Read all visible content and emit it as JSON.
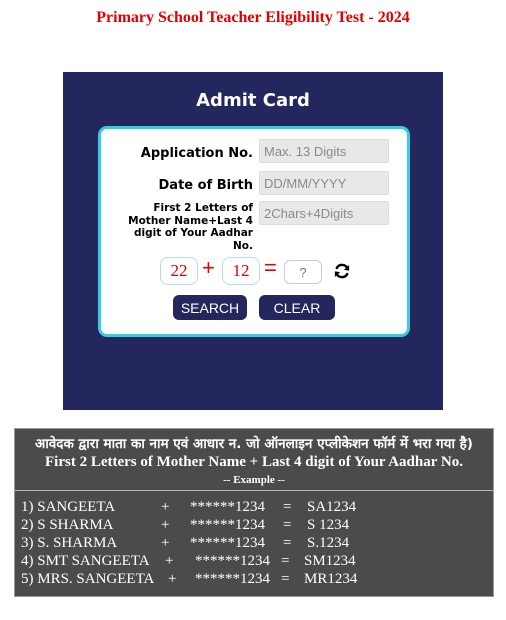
{
  "page_title": "Primary School Teacher Eligibility Test - 2024",
  "admit": {
    "title": "Admit Card",
    "application_label": "Application No.",
    "application_placeholder": "Max. 13 Digits",
    "dob_label": "Date of Birth",
    "dob_placeholder": "DD/MM/YYYY",
    "mother_label": "First 2 Letters of Mother Name+Last 4 digit of Your Aadhar No.",
    "mother_placeholder": "2Chars+4Digits",
    "captcha": {
      "num1": "22",
      "plus": "+",
      "num2": "12",
      "equals": "=",
      "answer_placeholder": "?"
    },
    "search_label": "SEARCH",
    "clear_label": "CLEAR"
  },
  "info": {
    "hindi": "आवेदक द्वारा माता का नाम  एवं आधार न. जो ऑनलाइन एप्लीकेशन फॉर्म में भरा गया है)",
    "english": "First 2 Letters of Mother Name + Last 4 digit of Your Aadhar No.",
    "example_heading": "-- Example --",
    "examples": [
      {
        "name": "1)  SANGEETA",
        "plus": "+",
        "aadhar": "******1234",
        "eq": "=",
        "result": "SA1234"
      },
      {
        "name": "2)  S SHARMA",
        "plus": "+",
        "aadhar": "******1234",
        "eq": "=",
        "result": "S 1234"
      },
      {
        "name": "3)  S. SHARMA",
        "plus": "+",
        "aadhar": "******1234",
        "eq": "=",
        "result": "S.1234"
      },
      {
        "name": "4) SMT SANGEETA",
        "plus": "+",
        "aadhar": "******1234",
        "eq": "=",
        "result": "SM1234"
      },
      {
        "name": "5) MRS. SANGEETA",
        "plus": "+",
        "aadhar": "******1234",
        "eq": "=",
        "result": "MR1234"
      }
    ]
  },
  "colors": {
    "title_red": "#e00000",
    "panel_navy": "#24265e",
    "card_border": "#30d0e0",
    "info_bg": "#4b4b4b"
  },
  "icons": {
    "refresh": "refresh-icon"
  }
}
